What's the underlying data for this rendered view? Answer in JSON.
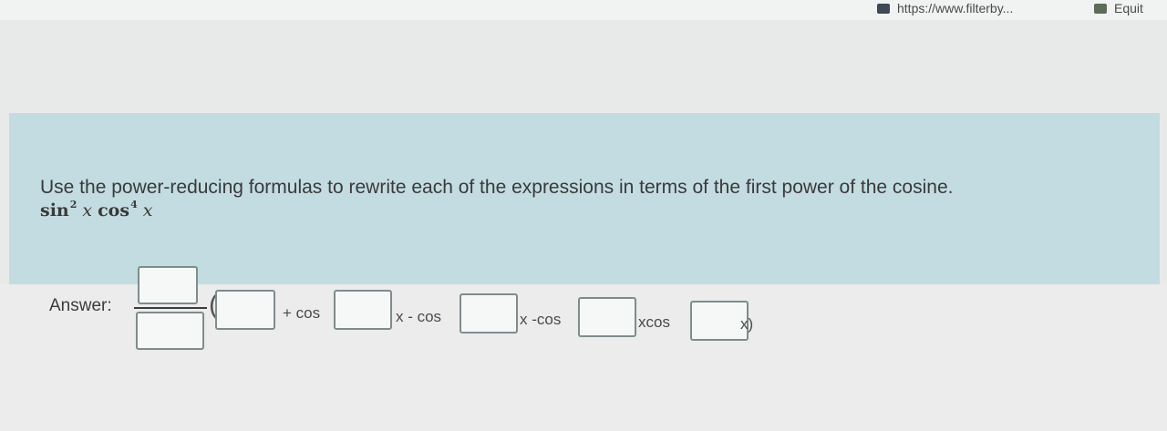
{
  "browser": {
    "bookmarks": [
      {
        "label": "https://www.filterby...",
        "icon": "bookmark-favicon"
      },
      {
        "label": "Equit",
        "icon": "bookmark-favicon"
      }
    ]
  },
  "question": {
    "instruction": "Use the power-reducing formulas to rewrite each of the expressions in terms of the first power of the cosine.",
    "expression": {
      "sin_text": "sin",
      "sin_power": "2",
      "var1": "x",
      "cos_text": "cos",
      "cos_power": "4",
      "var2": "x"
    }
  },
  "answer": {
    "label": "Answer:",
    "paren_open": "(",
    "terms": [
      "+ cos",
      "x - cos",
      "x -cos",
      "xcos",
      "x)"
    ],
    "inputs": {
      "numerator": "",
      "denominator": "",
      "coef_a": "",
      "coef_b": "",
      "coef_c": "",
      "coef_d": "",
      "coef_e": ""
    }
  }
}
